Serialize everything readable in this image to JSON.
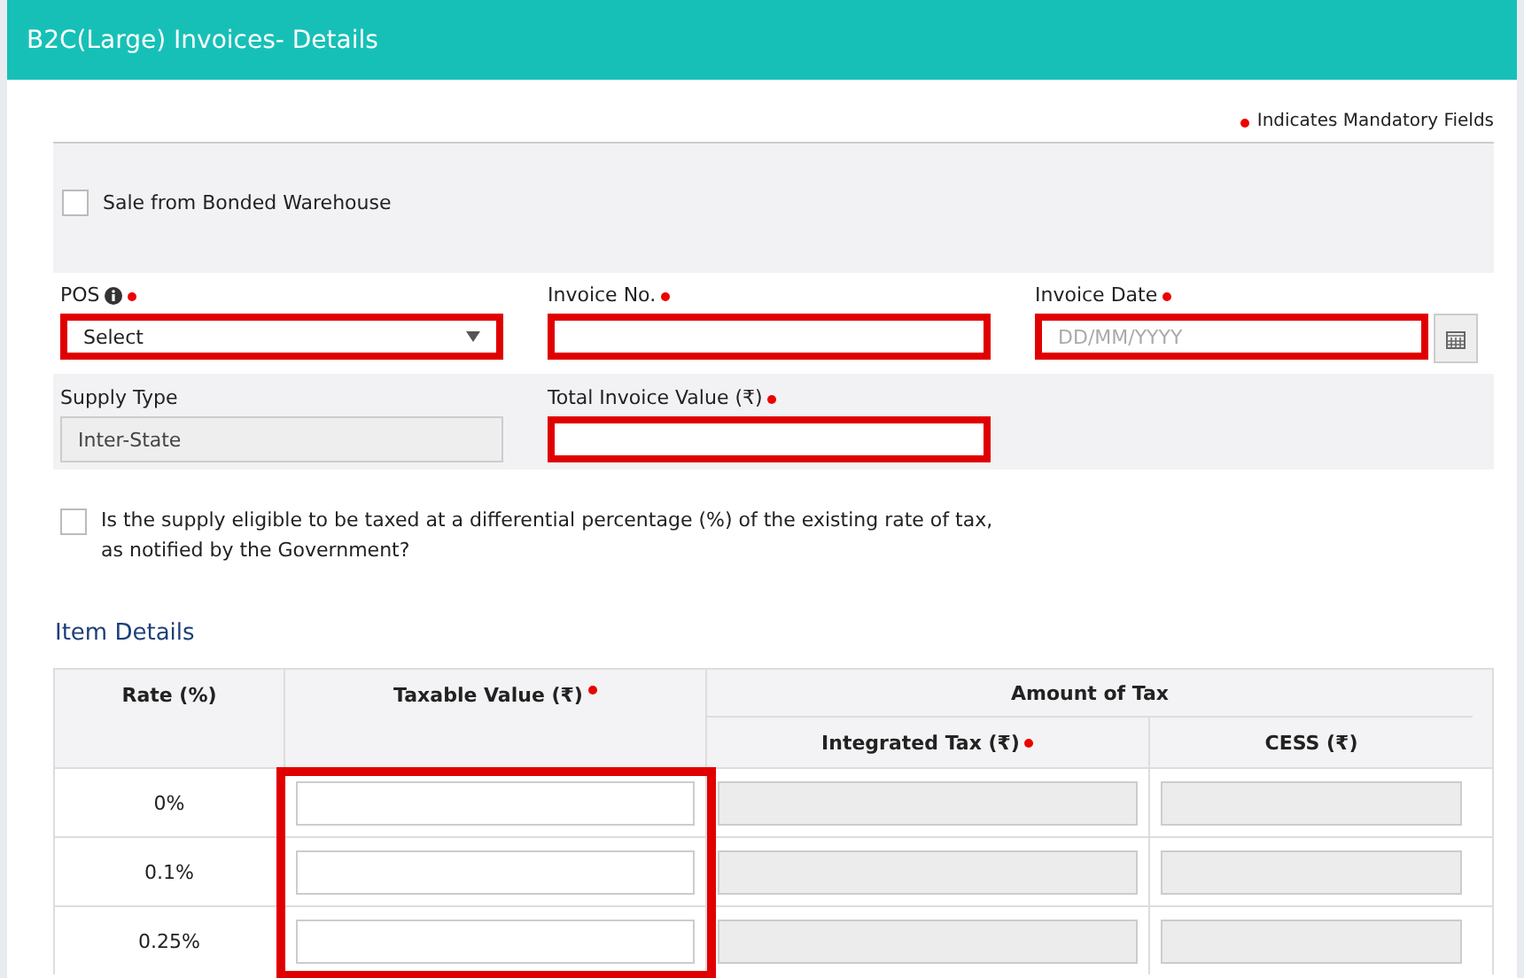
{
  "header": {
    "title": "B2C(Large) Invoices- Details"
  },
  "mandatory_note": "Indicates Mandatory Fields",
  "bonded_warehouse": {
    "label": "Sale from Bonded Warehouse",
    "checked": false
  },
  "form_rows": [
    {
      "fields": [
        {
          "label": "POS",
          "info": true,
          "required": true,
          "kind": "select",
          "value": "Select",
          "highlighted": true
        },
        {
          "label": "Invoice No.",
          "info": false,
          "required": true,
          "kind": "text",
          "highlighted": true
        },
        {
          "label": "Invoice Date",
          "info": false,
          "required": true,
          "kind": "date",
          "placeholder": "DD/MM/YYYY",
          "highlighted": true
        }
      ]
    },
    {
      "fields": [
        {
          "label": "Supply Type",
          "info": false,
          "required": false,
          "kind": "readonly",
          "value": "Inter-State",
          "highlighted": false
        },
        {
          "label": "Total Invoice Value (₹)",
          "info": false,
          "required": true,
          "kind": "text",
          "highlighted": true
        }
      ]
    }
  ],
  "differential": {
    "label": "Is the supply eligible to be taxed at a differential percentage (%) of the existing rate of tax, as notified by the Government?",
    "checked": false
  },
  "item_details": {
    "title": "Item Details",
    "columns": [
      {
        "label": "Rate (%)",
        "required": false,
        "highlighted": false
      },
      {
        "label": "Taxable Value (₹)",
        "required": true,
        "highlighted": true
      }
    ],
    "group": {
      "label": "Amount of Tax",
      "columns": [
        {
          "label": "Integrated Tax (₹)",
          "required": true
        },
        {
          "label": "CESS (₹)",
          "required": false
        }
      ]
    },
    "rows": [
      {
        "rate": "0%"
      },
      {
        "rate": "0.1%"
      },
      {
        "rate": "0.25%"
      }
    ]
  }
}
